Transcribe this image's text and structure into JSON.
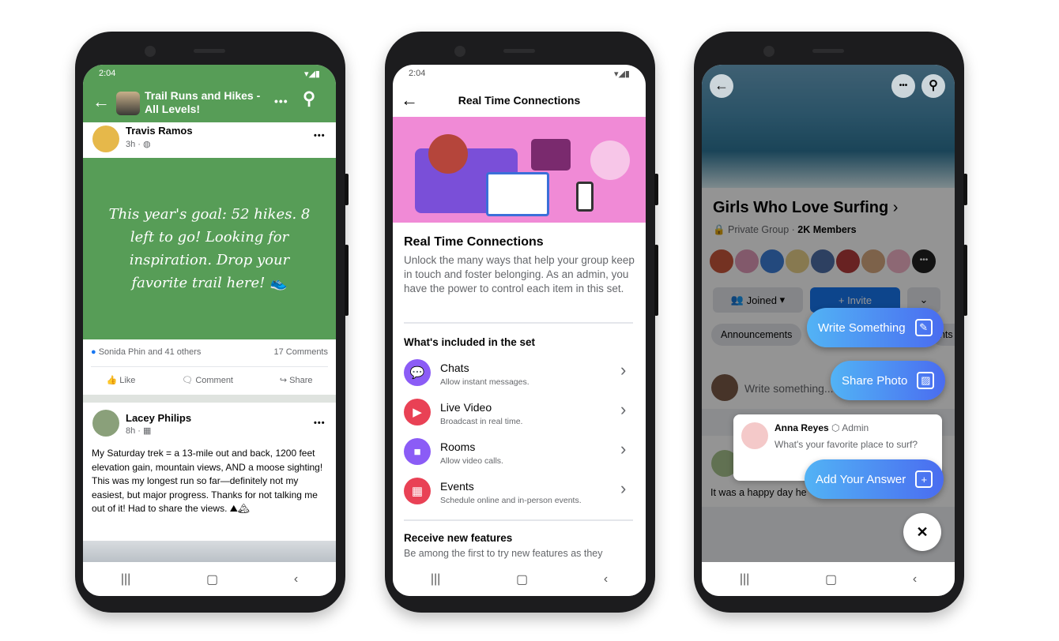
{
  "colors": {
    "group_green": "#579d57",
    "accent_blue": "#1877f2",
    "banner_pink": "#f08ad6",
    "fab_gradient_start": "#52b3f5",
    "fab_gradient_end": "#4a6cf0"
  },
  "phone1": {
    "status": {
      "time": "2:04",
      "icons": "▾◢▮"
    },
    "header": {
      "back_icon": "←",
      "title_line1": "Trail Runs and Hikes -",
      "title_line2": "All Levels!",
      "more_icon": "•••",
      "search_icon": "⚲"
    },
    "post1": {
      "author": "Travis Ramos",
      "meta": "3h · ◍",
      "more": "•••",
      "text": "This year's goal: 52 hikes. 8 left to go! Looking for inspiration. Drop your favorite trail here! 👟",
      "reactions": "Sonida Phin and 41 others",
      "comments": "17 Comments",
      "actions": [
        "Like",
        "Comment",
        "Share"
      ]
    },
    "post2": {
      "author": "Lacey Philips",
      "meta": "8h · ▦",
      "more": "•••",
      "text": "My Saturday trek = a 13-mile out and back, 1200 feet elevation gain, mountain views, AND a moose sighting! This was my longest run so far—definitely not my easiest, but major progress. Thanks for not talking me out of it! Had to share the views. ⛰🏔"
    },
    "nav": [
      "|||",
      "▢",
      "‹"
    ]
  },
  "phone2": {
    "status": {
      "time": "2:04",
      "icons": "▾◢▮"
    },
    "header": {
      "back_icon": "←",
      "title": "Real Time Connections"
    },
    "title": "Real Time Connections",
    "description": "Unlock the many ways that help your group keep in touch and foster belonging. As an admin, you have the power to control each item in this set.",
    "section": "What's included in the set",
    "items": [
      {
        "name": "Chats",
        "desc": "Allow instant messages.",
        "icon": "chat-icon",
        "glyph": "💬",
        "color": "#8b5cf6"
      },
      {
        "name": "Live Video",
        "desc": "Broadcast in real time.",
        "icon": "live-video-icon",
        "glyph": "▶",
        "color": "#e94155"
      },
      {
        "name": "Rooms",
        "desc": "Allow video calls.",
        "icon": "rooms-icon",
        "glyph": "■",
        "color": "#8b5cf6"
      },
      {
        "name": "Events",
        "desc": "Schedule online and in-person events.",
        "icon": "calendar-icon",
        "glyph": "▦",
        "color": "#e94155"
      }
    ],
    "receive_title": "Receive new features",
    "receive_desc": "Be among the first to try new features as they",
    "nav": [
      "|||",
      "▢",
      "‹"
    ]
  },
  "phone3": {
    "group_name": "Girls Who Love Surfing",
    "privacy": "Private Group",
    "members": "2K Members",
    "joined_label": "Joined",
    "invite_label": "+ Invite",
    "chips": [
      "Announcements",
      "ents"
    ],
    "composer_placeholder": "Write something...",
    "post_text": "It was a happy day he",
    "fabs": {
      "write": "Write Something",
      "share_photo": "Share Photo",
      "add_answer": "Add Your Answer"
    },
    "prompt_card": {
      "author": "Anna Reyes",
      "role": "Admin",
      "question": "What's your favorite place to surf?"
    },
    "close_icon": "✕",
    "nav": [
      "|||",
      "▢",
      "‹"
    ]
  }
}
